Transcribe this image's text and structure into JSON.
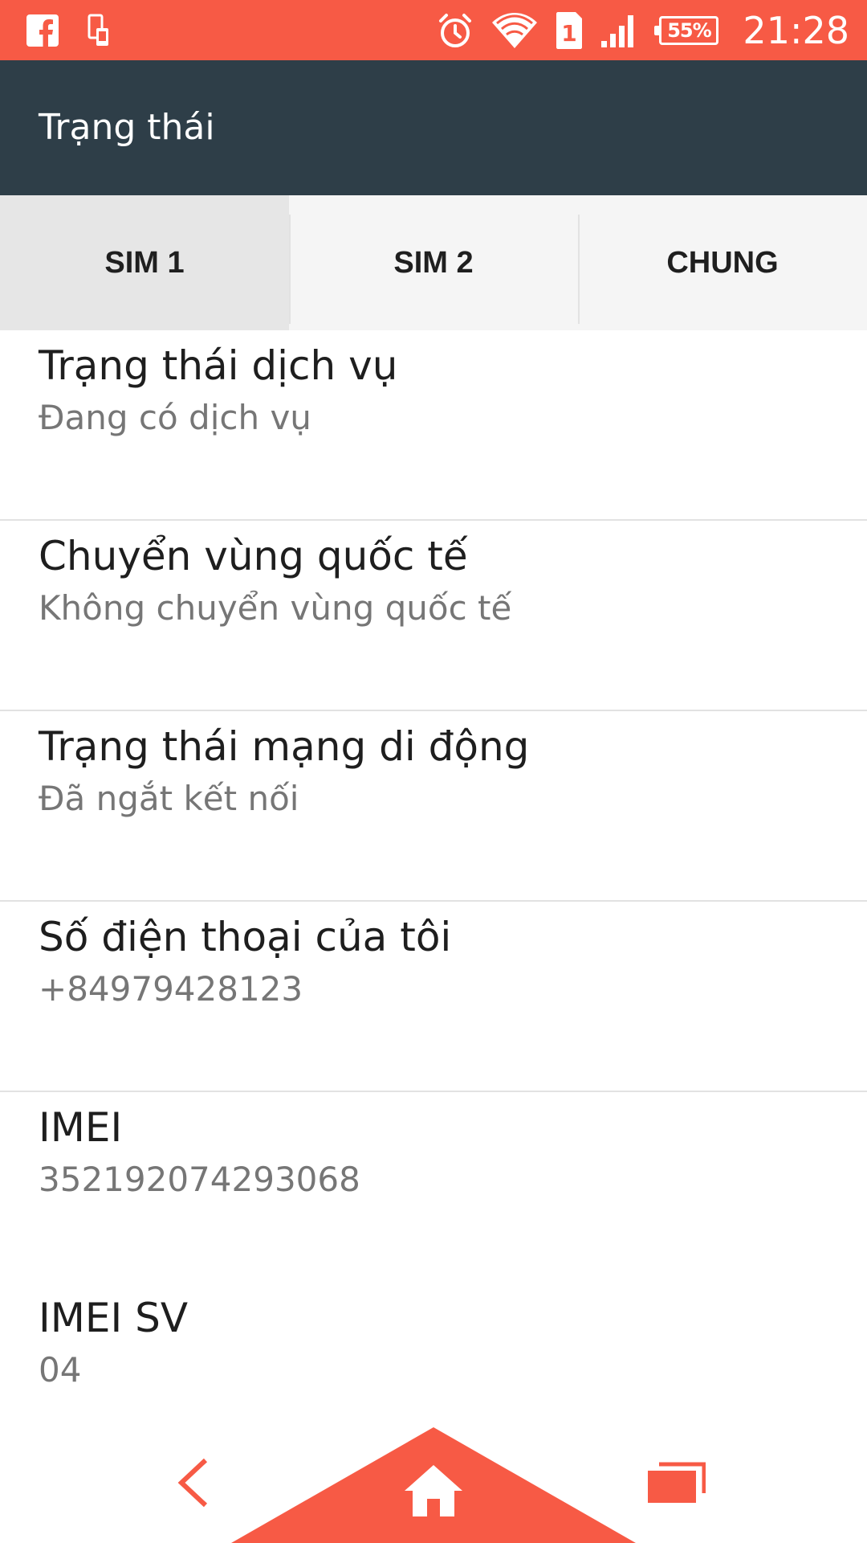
{
  "colors": {
    "status_bar": "#f75a45",
    "action_bar": "#2e3e48",
    "accent": "#f75a45"
  },
  "status_bar": {
    "left_icons": [
      "facebook-icon",
      "phone-notification-icon"
    ],
    "right_icons": [
      "alarm-icon",
      "wifi-icon",
      "sim-1-icon",
      "signal-icon"
    ],
    "sim_indicator": "1",
    "battery_level": "55%",
    "time": "21:28"
  },
  "action_bar": {
    "title": "Trạng thái"
  },
  "tabs": [
    {
      "label": "SIM 1",
      "selected": true
    },
    {
      "label": "SIM 2",
      "selected": false
    },
    {
      "label": "CHUNG",
      "selected": false
    }
  ],
  "list": {
    "items": [
      {
        "title": "Trạng thái dịch vụ",
        "value": "Đang có dịch vụ"
      },
      {
        "title": "Chuyển vùng quốc tế",
        "value": "Không chuyển vùng quốc tế"
      },
      {
        "title": "Trạng thái mạng di động",
        "value": "Đã ngắt kết nối"
      },
      {
        "title": "Số điện thoại của tôi",
        "value": "+84979428123"
      },
      {
        "title": "IMEI",
        "value": "352192074293068"
      },
      {
        "title": "IMEI SV",
        "value": "04"
      }
    ]
  },
  "nav_bar": {
    "icons": [
      "back-icon",
      "home-icon",
      "recents-icon"
    ]
  }
}
